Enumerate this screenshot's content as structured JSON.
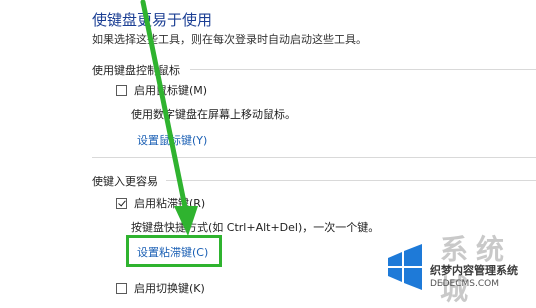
{
  "header": {
    "title": "使键盘更易于使用",
    "subtitle": "如果选择这些工具，则在每次登录时自动启动这些工具。"
  },
  "mouse_keys": {
    "section_title": "使用键盘控制鼠标",
    "checkbox_label": "启用鼠标键(M)",
    "checked": false,
    "description": "使用数字键盘在屏幕上移动鼠标。",
    "settings_link": "设置鼠标键(Y)"
  },
  "easier_typing": {
    "section_title": "使键入更容易",
    "sticky_label": "启用粘滞键(R)",
    "sticky_checked": true,
    "sticky_description": "按键盘快捷方式(如 Ctrl+Alt+Del)，一次一个键。",
    "sticky_settings_link": "设置粘滞键(C)",
    "toggle_label": "启用切换键(K)",
    "toggle_checked": false
  },
  "annotation": {
    "highlight_color": "#2fb32f",
    "arrow_color": "#2fb32f"
  },
  "watermark": {
    "brand": "系统城",
    "line1": "织梦内容管理系统",
    "line2": "DEDECMS.COM",
    "site": "xitongcheng.com"
  }
}
